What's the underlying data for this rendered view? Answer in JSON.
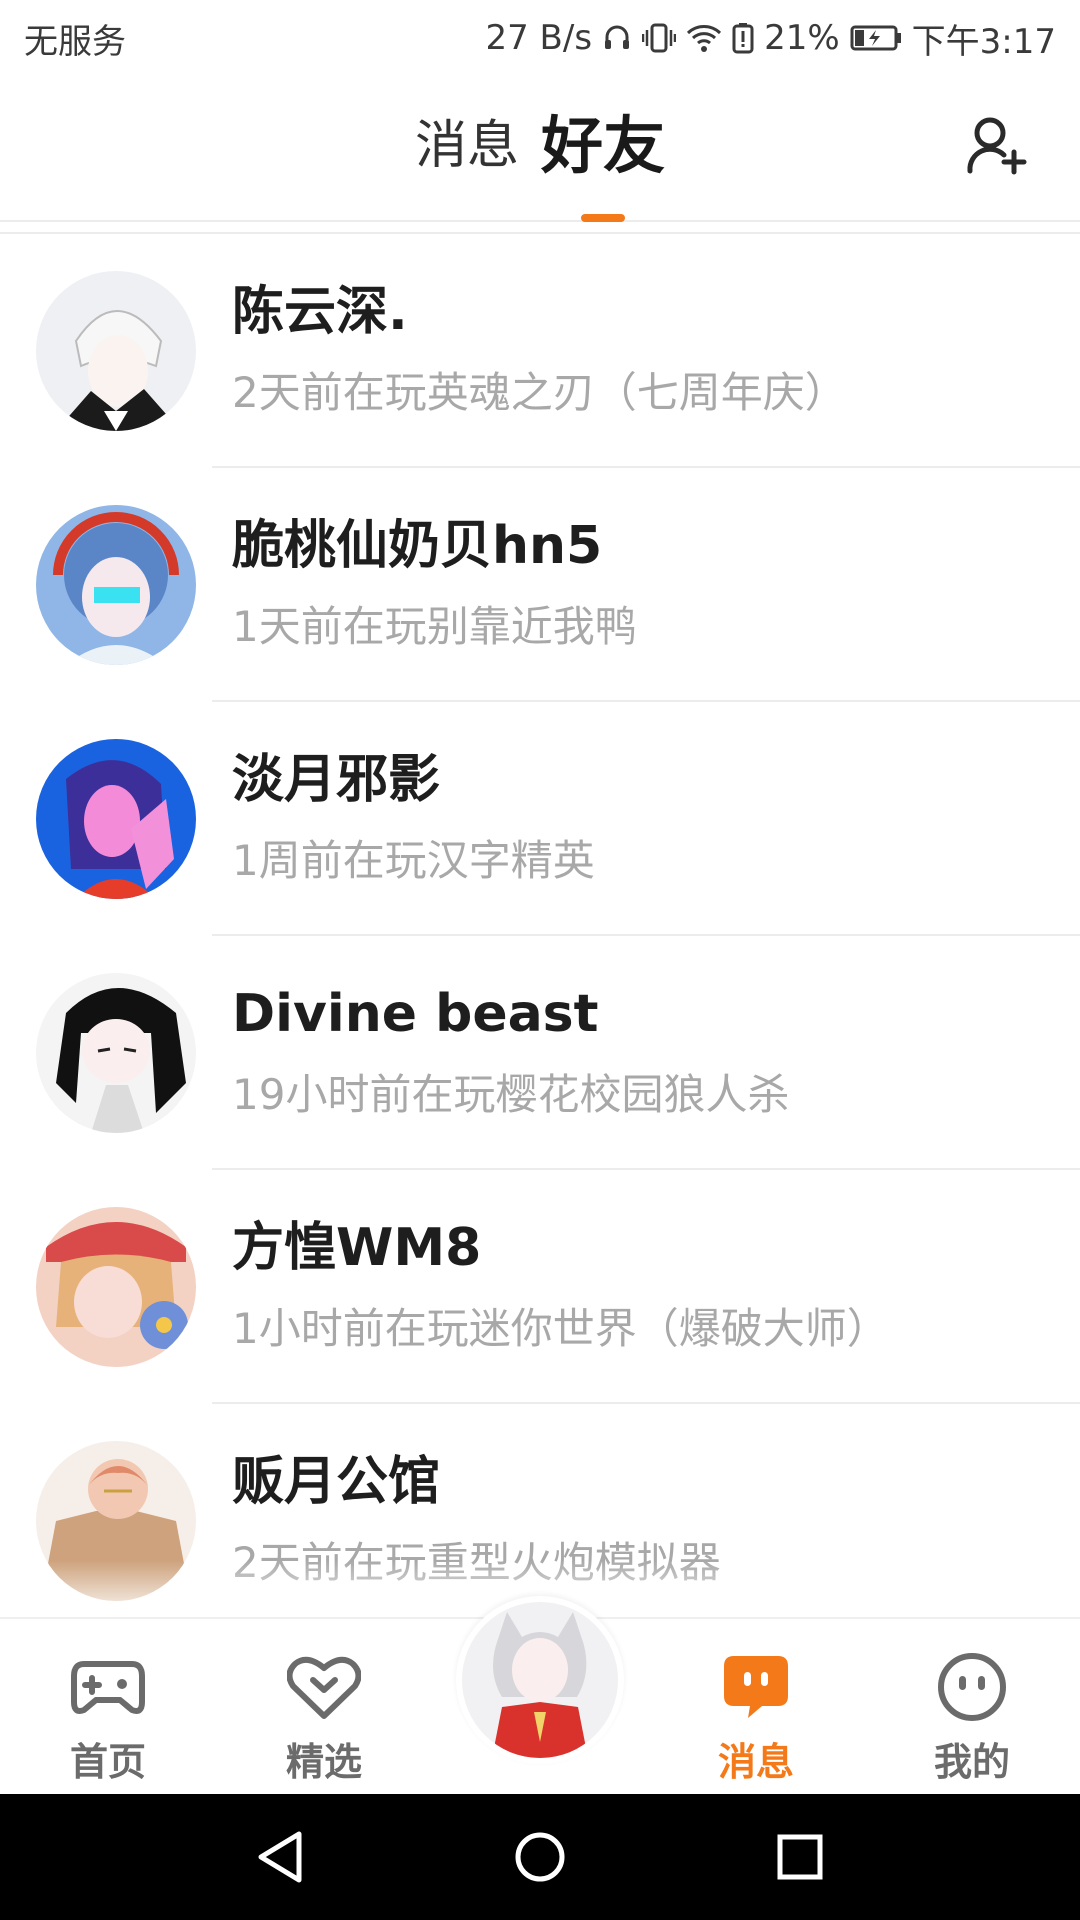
{
  "status_bar": {
    "carrier": "无服务",
    "speed": "27 B/s",
    "battery": "21%",
    "time": "下午3:17",
    "icons": [
      "headphones-icon",
      "vibrate-icon",
      "wifi-icon",
      "battery-alert-icon",
      "battery-icon"
    ]
  },
  "header": {
    "tabs": [
      {
        "label": "消息",
        "active": false
      },
      {
        "label": "好友",
        "active": true
      }
    ],
    "add_friend_icon": "add-friend-icon",
    "accent_color": "#f47a19"
  },
  "friends": [
    {
      "name": "陈云深.",
      "status": "2天前在玩英魂之刃（七周年庆）"
    },
    {
      "name": "脆桃仙奶贝hn5",
      "status": "1天前在玩别靠近我鸭"
    },
    {
      "name": "淡月邪影",
      "status": "1周前在玩汉字精英"
    },
    {
      "name": "Divine beast",
      "status": "19小时前在玩樱花校园狼人杀"
    },
    {
      "name": "方惶WM8",
      "status": "1小时前在玩迷你世界（爆破大师）"
    },
    {
      "name": "贩月公馆",
      "status": "2天前在玩重型火炮模拟器"
    }
  ],
  "bottom_nav": {
    "items": [
      {
        "label": "首页",
        "icon": "gamepad-icon",
        "active": false
      },
      {
        "label": "精选",
        "icon": "heart-icon",
        "active": false
      },
      {
        "label": "消息",
        "icon": "message-icon",
        "active": true
      },
      {
        "label": "我的",
        "icon": "smiley-icon",
        "active": false
      }
    ]
  },
  "system_nav": {
    "icons": [
      "back-icon",
      "home-icon",
      "recents-icon"
    ]
  }
}
